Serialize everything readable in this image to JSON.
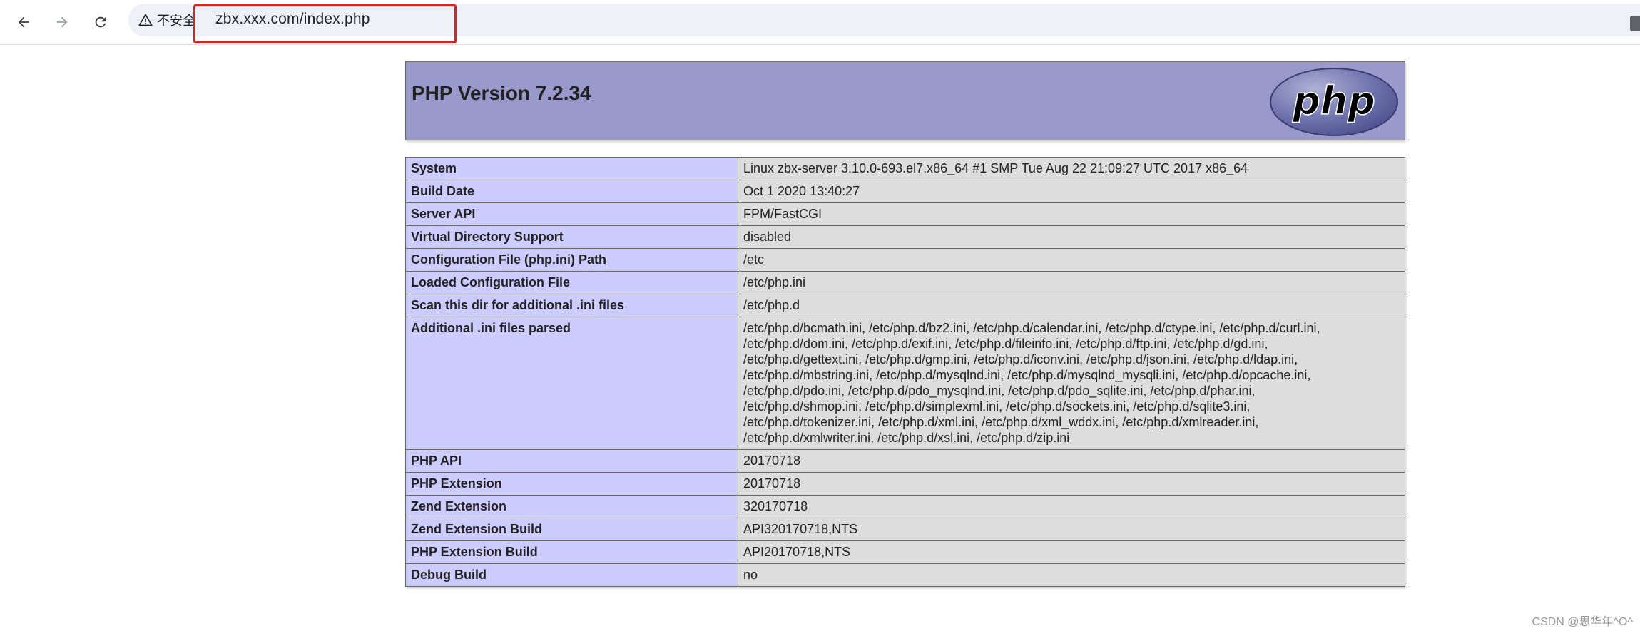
{
  "browser": {
    "security_label": "不安全",
    "url": "zbx.xxx.com/index.php",
    "highlight_color": "#e02020"
  },
  "phpinfo": {
    "title": "PHP Version 7.2.34",
    "logo_text": "php",
    "rows": [
      {
        "key": "System",
        "value": [
          "Linux zbx-server 3.10.0-693.el7.x86_64 #1 SMP Tue Aug 22 21:09:27 UTC 2017 x86_64"
        ]
      },
      {
        "key": "Build Date",
        "value": [
          "Oct 1 2020 13:40:27"
        ]
      },
      {
        "key": "Server API",
        "value": [
          "FPM/FastCGI"
        ]
      },
      {
        "key": "Virtual Directory Support",
        "value": [
          "disabled"
        ]
      },
      {
        "key": "Configuration File (php.ini) Path",
        "value": [
          "/etc"
        ]
      },
      {
        "key": "Loaded Configuration File",
        "value": [
          "/etc/php.ini"
        ]
      },
      {
        "key": "Scan this dir for additional .ini files",
        "value": [
          "/etc/php.d"
        ]
      },
      {
        "key": "Additional .ini files parsed",
        "value": [
          "/etc/php.d/bcmath.ini, /etc/php.d/bz2.ini, /etc/php.d/calendar.ini, /etc/php.d/ctype.ini, /etc/php.d/curl.ini,",
          "/etc/php.d/dom.ini, /etc/php.d/exif.ini, /etc/php.d/fileinfo.ini, /etc/php.d/ftp.ini, /etc/php.d/gd.ini,",
          "/etc/php.d/gettext.ini, /etc/php.d/gmp.ini, /etc/php.d/iconv.ini, /etc/php.d/json.ini, /etc/php.d/ldap.ini,",
          "/etc/php.d/mbstring.ini, /etc/php.d/mysqlnd.ini, /etc/php.d/mysqlnd_mysqli.ini, /etc/php.d/opcache.ini,",
          "/etc/php.d/pdo.ini, /etc/php.d/pdo_mysqlnd.ini, /etc/php.d/pdo_sqlite.ini, /etc/php.d/phar.ini,",
          "/etc/php.d/shmop.ini, /etc/php.d/simplexml.ini, /etc/php.d/sockets.ini, /etc/php.d/sqlite3.ini,",
          "/etc/php.d/tokenizer.ini, /etc/php.d/xml.ini, /etc/php.d/xml_wddx.ini, /etc/php.d/xmlreader.ini,",
          "/etc/php.d/xmlwriter.ini, /etc/php.d/xsl.ini, /etc/php.d/zip.ini"
        ]
      },
      {
        "key": "PHP API",
        "value": [
          "20170718"
        ]
      },
      {
        "key": "PHP Extension",
        "value": [
          "20170718"
        ]
      },
      {
        "key": "Zend Extension",
        "value": [
          "320170718"
        ]
      },
      {
        "key": "Zend Extension Build",
        "value": [
          "API320170718,NTS"
        ]
      },
      {
        "key": "PHP Extension Build",
        "value": [
          "API20170718,NTS"
        ]
      },
      {
        "key": "Debug Build",
        "value": [
          "no"
        ]
      }
    ],
    "colors": {
      "header_bg": "#9999cc",
      "key_bg": "#ccccff",
      "value_bg": "#dddddd"
    }
  },
  "watermark": "CSDN @思华年^O^"
}
